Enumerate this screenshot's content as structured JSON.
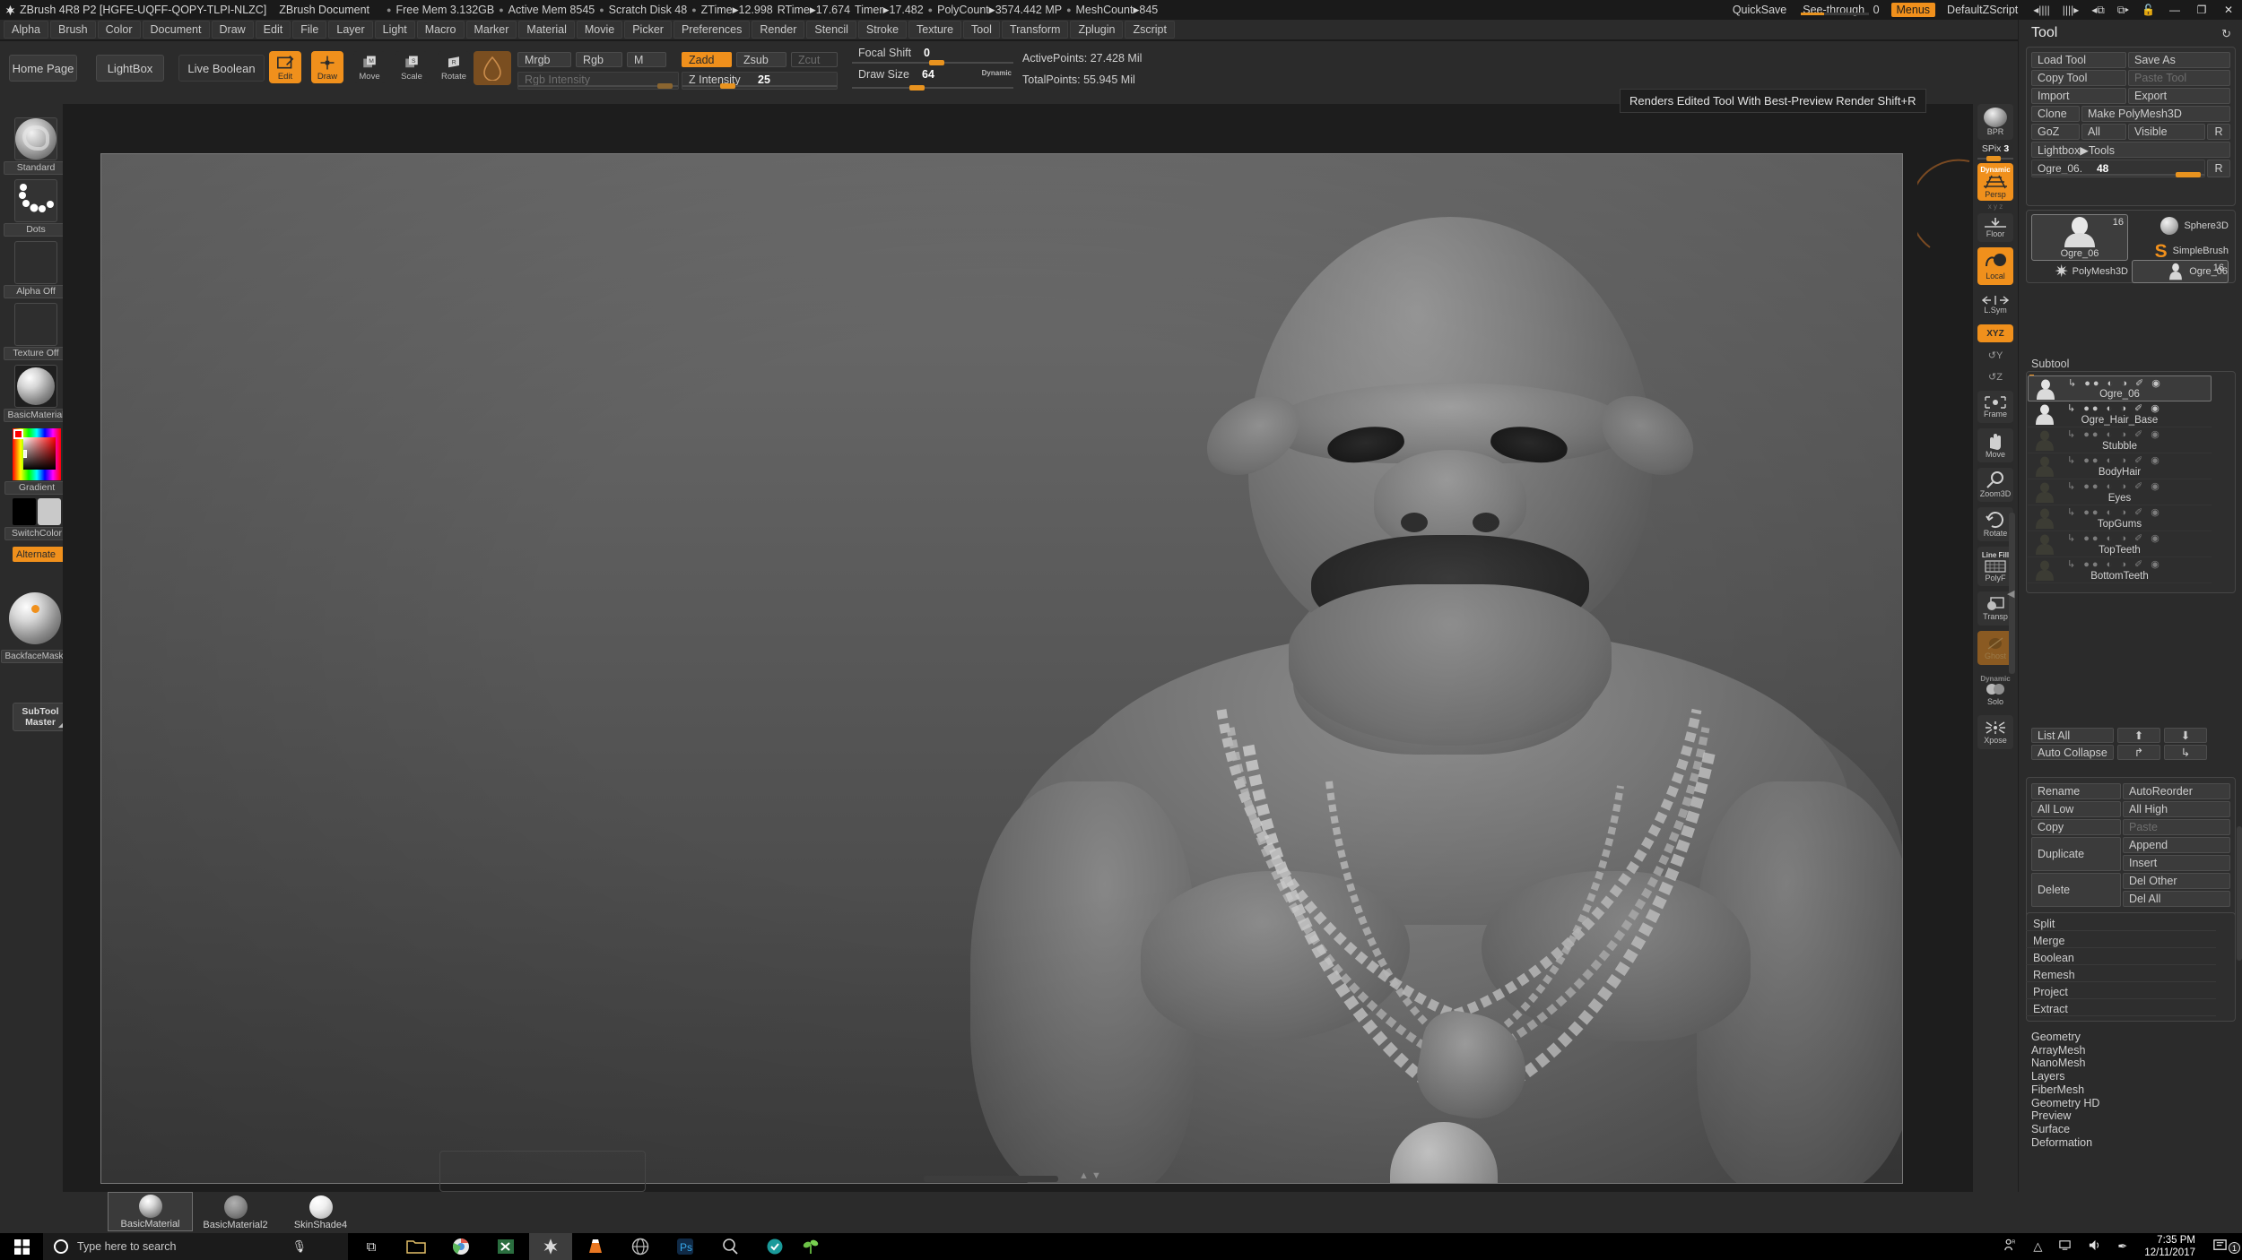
{
  "titlebar": {
    "app_title": "ZBrush 4R8 P2 [HGFE-UQFF-QOPY-TLPI-NLZC]",
    "document": "ZBrush Document",
    "free_mem": "Free Mem 3.132GB",
    "active_mem": "Active Mem 8545",
    "scratch_disk": "Scratch Disk 48",
    "ztime_label": "ZTime",
    "ztime": "12.998",
    "rtime_label": "RTime",
    "rtime": "17.674",
    "timer_label": "Timer",
    "timer": "17.482",
    "polycount_label": "PolyCount",
    "polycount": "3574.442 MP",
    "meshcount_label": "MeshCount",
    "meshcount": "845",
    "quicksave": "QuickSave",
    "seethrough_label": "See-through",
    "seethrough_value": "0",
    "menus": "Menus",
    "zscript": "DefaultZScript",
    "lock_icon": "unlock-icon",
    "minimize": "—",
    "maximize": "❐",
    "close": "✕"
  },
  "menubar": {
    "items": [
      "Alpha",
      "Brush",
      "Color",
      "Document",
      "Draw",
      "Edit",
      "File",
      "Layer",
      "Light",
      "Macro",
      "Marker",
      "Material",
      "Movie",
      "Picker",
      "Preferences",
      "Render",
      "Stencil",
      "Stroke",
      "Texture",
      "Tool",
      "Transform",
      "Zplugin",
      "Zscript"
    ]
  },
  "shelf": {
    "home_page": "Home Page",
    "lightbox": "LightBox",
    "live_boolean": "Live Boolean",
    "edit": "Edit",
    "draw": "Draw",
    "move": "Move",
    "scale": "Scale",
    "rotate": "Rotate",
    "mrgb": "Mrgb",
    "rgb": "Rgb",
    "m": "M",
    "zadd": "Zadd",
    "zsub": "Zsub",
    "zcut": "Zcut",
    "rgb_intensity": "Rgb Intensity",
    "z_intensity_label": "Z Intensity",
    "z_intensity_value": "25",
    "focal_shift_label": "Focal Shift",
    "focal_shift_value": "0",
    "draw_size_label": "Draw Size",
    "draw_size_value": "64",
    "dynamic": "Dynamic",
    "active_points": "ActivePoints: 27.428 Mil",
    "total_points": "TotalPoints: 55.945 Mil"
  },
  "left_shelf": {
    "brush": "Standard",
    "stroke": "Dots",
    "alpha": "Alpha Off",
    "texture": "Texture Off",
    "material": "BasicMaterial",
    "gradient": "Gradient",
    "switch_color": "SwitchColor",
    "alternate": "Alternate",
    "backface_mask": "BackfaceMask",
    "subtool_master_line1": "SubTool",
    "subtool_master_line2": "Master"
  },
  "canvas": {
    "tooltip": "Renders Edited Tool With Best-Preview Render  Shift+R"
  },
  "rail": {
    "bpr": "BPR",
    "spix_label": "SPix",
    "spix_value": "3",
    "persp_dynamic": "Dynamic",
    "persp": "Persp",
    "xyz_small": "x y z",
    "floor": "Floor",
    "local": "Local",
    "lsym": "L.Sym",
    "xyz": "XYZ",
    "y_axis": "Y",
    "z_axis": "Z",
    "frame": "Frame",
    "move": "Move",
    "zoom3d": "Zoom3D",
    "rotate": "Rotate",
    "line_fill": "Line Fill",
    "polyf": "PolyF",
    "transp": "Transp",
    "ghost": "Ghost",
    "solo_dynamic": "Dynamic",
    "solo": "Solo",
    "xpose": "Xpose"
  },
  "palette": {
    "title": "Tool",
    "reload_icon": "reload-icon",
    "buttons": {
      "load_tool": "Load Tool",
      "save_as": "Save As",
      "copy_tool": "Copy Tool",
      "paste_tool": "Paste Tool",
      "import": "Import",
      "export": "Export",
      "clone": "Clone",
      "make_polymesh3d": "Make PolyMesh3D",
      "goz": "GoZ",
      "all": "All",
      "visible": "Visible",
      "r1": "R",
      "lightbox_tools": "Lightbox▶Tools",
      "tool_slider_label": "Ogre_06.",
      "tool_slider_value": "48",
      "r2": "R"
    },
    "tool_tiles": [
      {
        "label": "Ogre_06",
        "count": "16",
        "selected": true,
        "icon": "ogre-thumb"
      },
      {
        "label": "Sphere3D",
        "count": "",
        "selected": false,
        "icon": "sphere-icon"
      },
      {
        "label": "PolyMesh3D",
        "count": "",
        "selected": false,
        "icon": "star-icon"
      },
      {
        "label": "SimpleBrush",
        "count": "",
        "selected": false,
        "icon": "s-brush-icon"
      },
      {
        "label": "Ogre_06",
        "count": "16",
        "selected": true,
        "icon": "ogre-thumb"
      }
    ],
    "subtool_header": "Subtool",
    "subtools": [
      {
        "name": "Ogre_06",
        "selected": true
      },
      {
        "name": "Ogre_Hair_Base",
        "selected": false
      },
      {
        "name": "Stubble",
        "selected": false
      },
      {
        "name": "BodyHair",
        "selected": false
      },
      {
        "name": "Eyes",
        "selected": false
      },
      {
        "name": "TopGums",
        "selected": false
      },
      {
        "name": "TopTeeth",
        "selected": false
      },
      {
        "name": "BottomTeeth",
        "selected": false
      }
    ],
    "list_controls": {
      "list_all": "List All",
      "auto_collapse": "Auto Collapse",
      "up_arrow": "⬆",
      "down_arrow": "⬇",
      "left_arrow": "↱",
      "right_arrow": "↳"
    },
    "actions": {
      "rename": "Rename",
      "autoreorder": "AutoReorder",
      "all_low": "All Low",
      "all_high": "All High",
      "copy": "Copy",
      "paste": "Paste",
      "duplicate": "Duplicate",
      "append": "Append",
      "insert": "Insert",
      "delete": "Delete",
      "del_other": "Del Other",
      "del_all": "Del All"
    },
    "ops": [
      "Split",
      "Merge",
      "Boolean",
      "Remesh",
      "Project",
      "Extract"
    ],
    "sections": [
      "Geometry",
      "ArrayMesh",
      "NanoMesh",
      "Layers",
      "FiberMesh",
      "Geometry HD",
      "Preview",
      "Surface",
      "Deformation"
    ]
  },
  "bottom_shelf": {
    "materials": [
      {
        "label": "BasicMaterial",
        "selected": true
      },
      {
        "label": "BasicMaterial2",
        "selected": false
      },
      {
        "label": "SkinShade4",
        "selected": false
      }
    ]
  },
  "taskbar": {
    "start_icon": "windows-icon",
    "search_placeholder": "Type here to search",
    "cortana_icon": "circle-icon",
    "mic_icon": "microphone-icon",
    "taskview_icon": "task-view-icon",
    "apps": [
      "folder-icon",
      "chrome-icon",
      "excel-icon",
      "zbrush-icon",
      "vlc-icon",
      "browser-icon",
      "photoshop-icon",
      "magnifier-icon",
      "teal-app-icon",
      "plant-icon"
    ],
    "tray": {
      "people_icon": "people-icon",
      "chevron_icon": "chevron-up-icon",
      "network_icon": "network-icon",
      "volume_icon": "volume-icon",
      "pen_icon": "pen-icon",
      "time": "7:35 PM",
      "date": "12/11/2017",
      "notifications_icon": "notification-icon",
      "notifications_count": "1"
    }
  },
  "colors": {
    "accent": "#f0901c",
    "panel": "#2b2b2b",
    "canvas": "#1d1d1d",
    "text": "#cdcdcd"
  }
}
